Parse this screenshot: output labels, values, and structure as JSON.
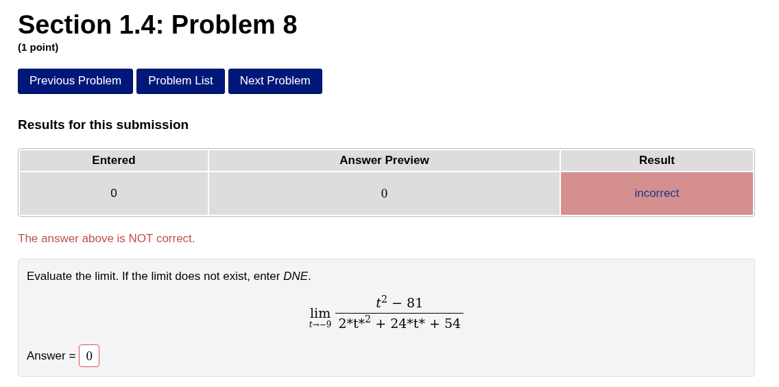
{
  "header": {
    "title": "Section 1.4: Problem 8",
    "points": "(1 point)"
  },
  "nav_buttons": [
    "Previous Problem",
    "Problem List",
    "Next Problem"
  ],
  "results": {
    "heading": "Results for this submission",
    "columns": [
      "Entered",
      "Answer Preview",
      "Result"
    ],
    "rows": [
      {
        "entered": "0",
        "preview": "0",
        "result": "incorrect",
        "kind": "incorrect"
      }
    ],
    "message": "The answer above is NOT correct."
  },
  "problem": {
    "statement": "Evaluate the limit. If the limit does not exist, enter *DNE*.",
    "formula": {
      "operator": "lim",
      "subscript": "*t*→−9",
      "numerator": "*t*$^{2}$ − 81",
      "denominator": "2*t*$^{2}$ + 24*t* + 54"
    },
    "answer": {
      "label": "Answer =",
      "value": "0",
      "kind": "incorrect"
    }
  }
}
